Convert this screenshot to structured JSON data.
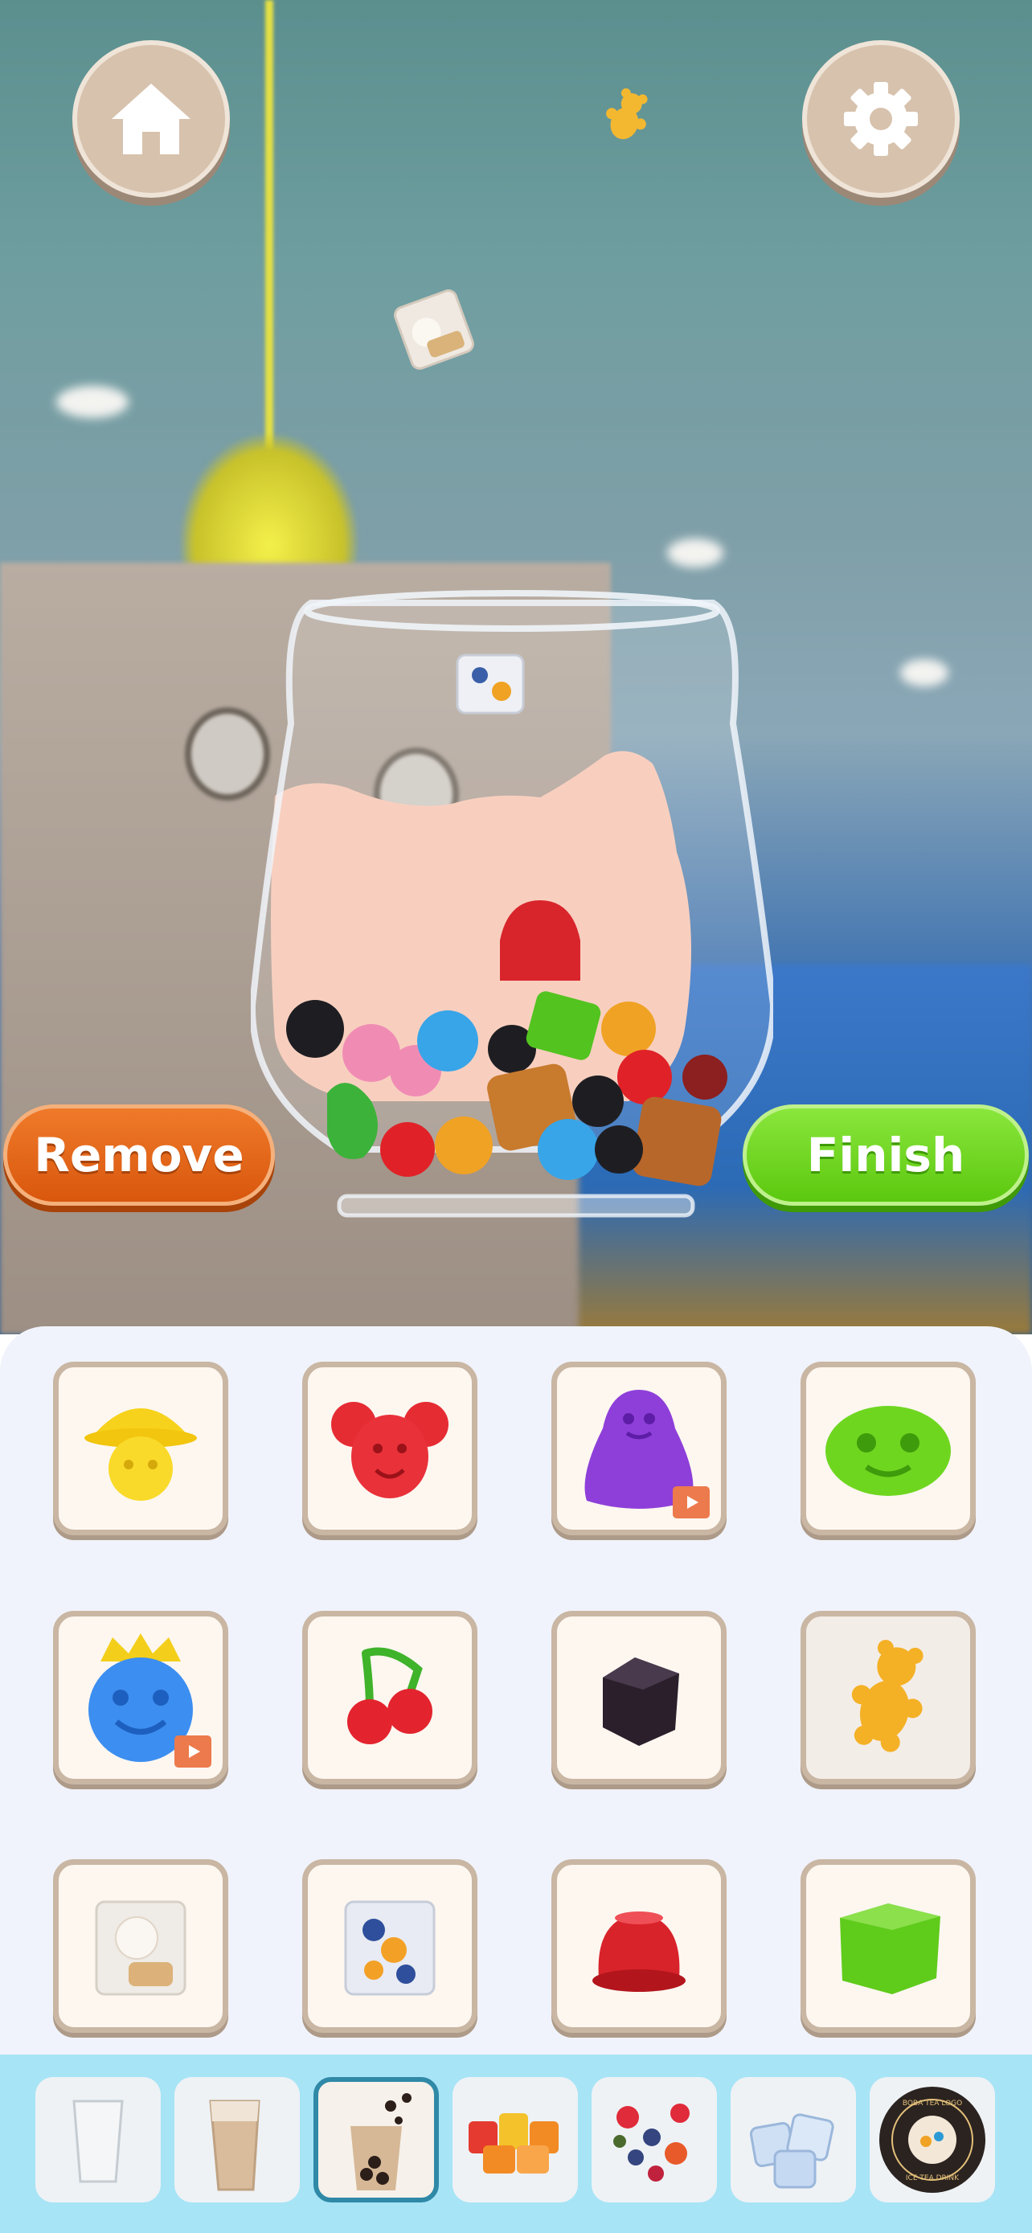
{
  "header": {
    "home_icon": "home-icon",
    "settings_icon": "gear-icon"
  },
  "actions": {
    "remove_label": "Remove",
    "finish_label": "Finish"
  },
  "colors": {
    "remove": "#e0651b",
    "finish": "#6fd421",
    "panel": "#f0f3fb",
    "tile_border": "#c9b6a3",
    "tabbar": "#a7e4f6",
    "tab_selected_border": "#2f89a7"
  },
  "toppings": [
    {
      "name": "yellow-hat-jelly",
      "ad": false
    },
    {
      "name": "red-bear-jelly",
      "ad": false
    },
    {
      "name": "purple-blob-jelly",
      "ad": true
    },
    {
      "name": "green-smile-jelly",
      "ad": false
    },
    {
      "name": "blue-crown-jelly",
      "ad": true
    },
    {
      "name": "cherry-gummy",
      "ad": false
    },
    {
      "name": "black-grass-jelly",
      "ad": false
    },
    {
      "name": "gummy-bear",
      "ad": false,
      "selected": true
    },
    {
      "name": "lychee-jelly-cube",
      "ad": false
    },
    {
      "name": "fruit-jelly-cube",
      "ad": false
    },
    {
      "name": "red-pudding-jelly",
      "ad": false
    },
    {
      "name": "green-jelly-cube",
      "ad": false
    }
  ],
  "tabs": [
    {
      "name": "cup"
    },
    {
      "name": "milk-tea"
    },
    {
      "name": "boba",
      "selected": true
    },
    {
      "name": "jelly"
    },
    {
      "name": "fruit"
    },
    {
      "name": "ice"
    },
    {
      "name": "logo",
      "text_top": "BOBA TEA LOGO",
      "text_bottom": "ICE TEA DRINK"
    }
  ]
}
